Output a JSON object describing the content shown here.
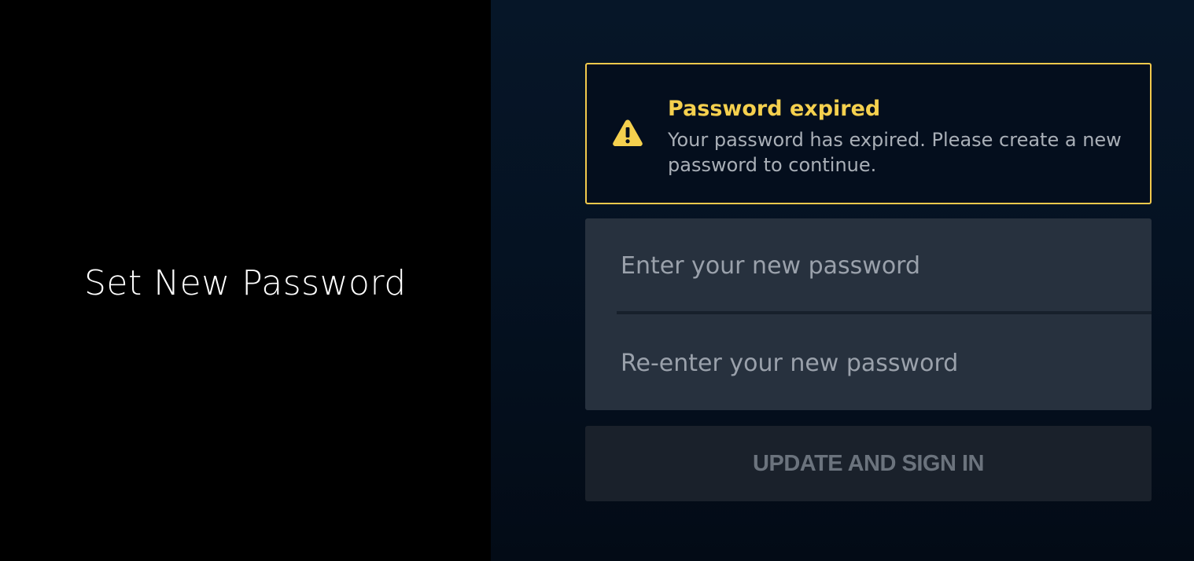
{
  "left_panel": {
    "title": "Set New Password"
  },
  "alert": {
    "icon": "warning-triangle-icon",
    "title": "Password expired",
    "message": "Your password has expired. Please create a new password to continue.",
    "accent_color": "#f2c94c"
  },
  "form": {
    "new_password": {
      "placeholder": "Enter your new password",
      "value": ""
    },
    "confirm_password": {
      "placeholder": "Re-enter your new password",
      "value": ""
    },
    "submit_label": "UPDATE AND SIGN IN"
  }
}
